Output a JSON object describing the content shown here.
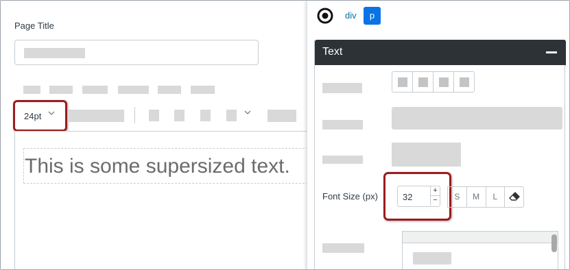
{
  "editor": {
    "page_title_label": "Page Title",
    "font_size_selected": "24pt",
    "chevron": "chevron-down-icon",
    "content_text": "This is some supersized text."
  },
  "sidebar": {
    "breadcrumb": [
      "div",
      "p"
    ],
    "target_icon": "target-icon",
    "panel_title": "Text",
    "collapse_icon": "minus-icon",
    "font_size": {
      "label": "Font Size (px)",
      "value": "32",
      "increment": "+",
      "decrement": "−"
    },
    "size_presets": [
      "S",
      "M",
      "L"
    ],
    "clear_icon": "eraser-icon"
  },
  "colors": {
    "highlight": "#9b1c1c",
    "panel_header": "#2d3236",
    "accent_blue": "#0b74e5",
    "link_blue": "#0770a3",
    "placeholder": "#d9d9d9"
  }
}
